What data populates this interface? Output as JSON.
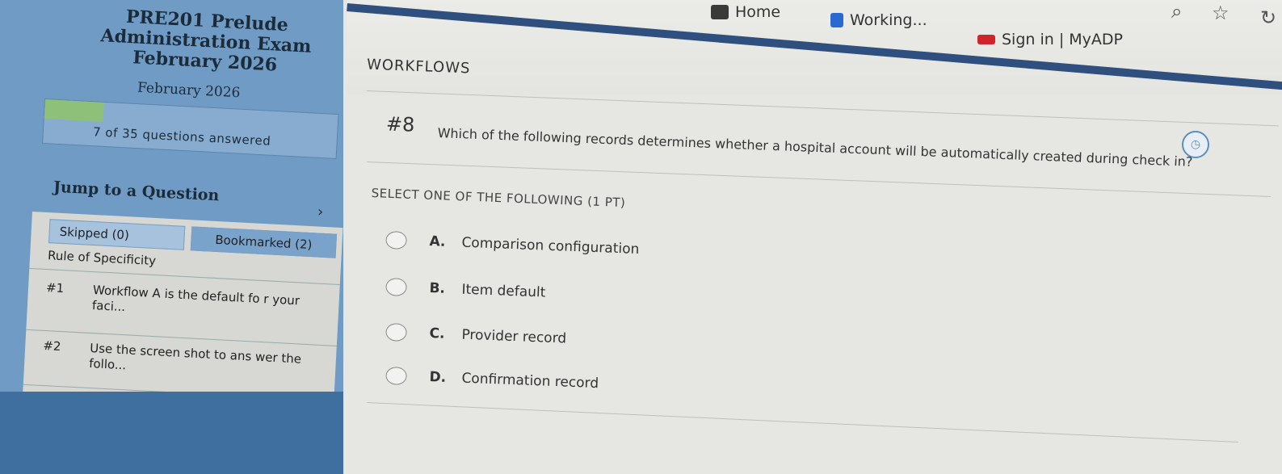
{
  "browser": {
    "bookmarks": [
      {
        "label": "Home",
        "icon": "home-bookmark-icon",
        "color": "#333333"
      },
      {
        "label": "Working...",
        "icon": "working-bookmark-icon",
        "color": "#2a6ad0"
      },
      {
        "label": "Sign in | MyADP",
        "icon": "adp-logo-icon",
        "color": "#d0242c"
      }
    ],
    "icons": [
      "zoom-icon",
      "star-icon",
      "refresh-icon"
    ]
  },
  "sidebar": {
    "course_title": "PRE201 Prelude Administration Exam February 2026",
    "date": "February 2026",
    "progress": {
      "answered": 7,
      "total": 35,
      "fraction": 0.2,
      "label": "7 of 35 questions answered"
    },
    "jump_label": "Jump to a Question",
    "skipped_label": "Skipped (0)",
    "bookmarked_label": "Bookmarked (2)",
    "section": "Rule of Specificity",
    "questions": [
      {
        "num": "#1",
        "text": "Workflow A is the default fo r your faci..."
      },
      {
        "num": "#2",
        "text": "Use the screen shot to ans wer the follo..."
      }
    ]
  },
  "main": {
    "category": "WORKFLOWS",
    "question_number": "#8",
    "question_text": "Which of the following records determines whether a hospital account will be automatically created during check in?",
    "instruction": "SELECT ONE OF THE FOLLOWING (1 PT)",
    "options": [
      {
        "letter": "A.",
        "text": "Comparison configuration"
      },
      {
        "letter": "B.",
        "text": "Item default"
      },
      {
        "letter": "C.",
        "text": "Provider record"
      },
      {
        "letter": "D.",
        "text": "Confirmation record"
      }
    ]
  },
  "colors": {
    "sidebar": "#6f9bc4",
    "accent": "#2f4f7e",
    "progress": "#8ec07a"
  }
}
